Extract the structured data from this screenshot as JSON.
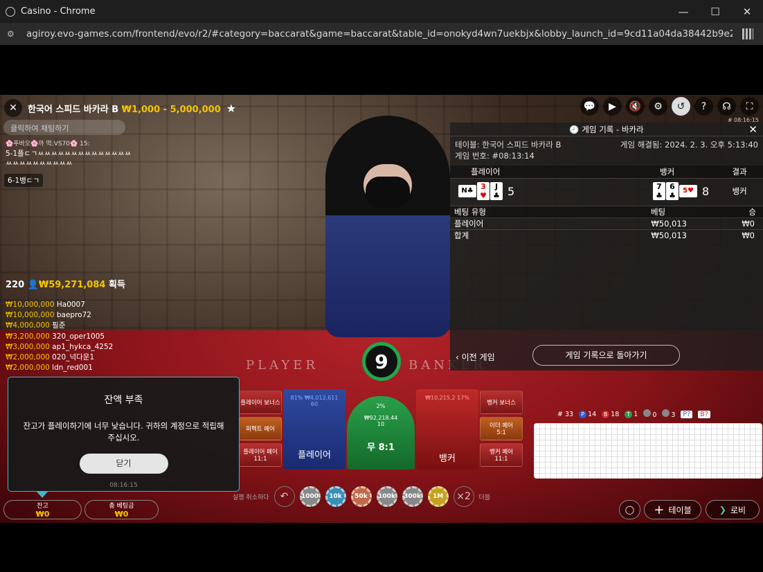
{
  "window": {
    "title": "Casino - Chrome",
    "url": "agiroy.evo-games.com/frontend/evo/r2/#category=baccarat&game=baccarat&table_id=onokyd4wn7uekbjx&lobby_launch_id=9cd11a04da38442b9e233af824b..."
  },
  "game": {
    "table_name": "한국어 스피드 바카라 B",
    "limits": "₩1,000 - 5,000,000",
    "round_id": "# 08:16:15",
    "timer": "9",
    "felt_player": "PLAYER",
    "felt_banker": "BANKER"
  },
  "chat": {
    "placeholder": "클릭하여 채팅하기",
    "meta": "🌸푸바오🌸까 먹:VS70🌸 15:",
    "message": "5-1플ㄷㄱㅆㅆㅆㅆㅆㅆㅆㅆㅆㅆㅆㅆㅆㅆㅆㅆㅆㅆㅆㅆㅆㅆㅆㅆ",
    "pill": "6-1뱅ㄷㄱ"
  },
  "winners": {
    "count": "220",
    "total": "₩59,271,084",
    "suffix": "획득",
    "list": [
      {
        "amount": "₩10,000,000",
        "name": "Ha0007"
      },
      {
        "amount": "₩10,000,000",
        "name": "baepro72"
      },
      {
        "amount": "₩4,000,000",
        "name": "필준"
      },
      {
        "amount": "₩3,200,000",
        "name": "320_oper1005"
      },
      {
        "amount": "₩3,000,000",
        "name": "ap1_hykca_4252"
      },
      {
        "amount": "₩2,000,000",
        "name": "020_넉다운1"
      },
      {
        "amount": "₩2,000,000",
        "name": "ldn_red001"
      }
    ]
  },
  "history": {
    "title": "게임 기록 - 바카라",
    "table": "테이블: 한국어 스피드 바카라 B",
    "resolved": "게임 해결됨: 2024. 2. 3. 오후 5:13:40",
    "game_no": "게임 번호: #08:13:14",
    "col_player": "플레이어",
    "col_banker": "뱅커",
    "col_result": "결과",
    "player_score": "5",
    "banker_score": "8",
    "result": "뱅커",
    "bet_type": "베팅 유형",
    "bet_col": "베팅",
    "win_col": "승",
    "rows": [
      {
        "type": "플레이어",
        "bet": "₩50,013",
        "win": "₩0"
      },
      {
        "type": "합계",
        "bet": "₩50,013",
        "win": "₩0"
      }
    ],
    "prev": "이전 게임",
    "back": "게임 기록으로 돌아가기"
  },
  "bets": {
    "player_bonus": "플레이어 보너스",
    "perfect_pair": "퍼펙트 페어",
    "player_pair": "플레이어 페어",
    "player_pair_odds": "11:1",
    "player": "플레이어",
    "player_pct": "81%",
    "player_amount": "₩4,012,611",
    "player_count": "60",
    "tie": "무 8:1",
    "tie_pct": "2%",
    "tie_amount": "₩92,218.44",
    "tie_count": "10",
    "banker": "뱅커",
    "banker_amount": "₩10,215,2",
    "banker_pct": "17%",
    "banker_bonus": "뱅커 보너스",
    "either_pair": "이더 페어",
    "either_pair_odds": "5:1",
    "banker_pair": "뱅커 페어",
    "banker_pair_odds": "11:1"
  },
  "road": {
    "total": "# 33",
    "p_label": "P",
    "p": "14",
    "b_label": "B",
    "b": "18",
    "t_label": "T",
    "t": "1",
    "pp": "0",
    "bp": "3",
    "p_ask": "P?",
    "b_ask": "B?"
  },
  "chips": {
    "undo_label": "실행 취소하다",
    "values": [
      "1000",
      "10k",
      "50k",
      "100k",
      "300k",
      "1M"
    ],
    "double": "×2",
    "double_label": "더블"
  },
  "footer": {
    "balance_label": "잔고",
    "balance": "₩0",
    "totalbet_label": "총 베팅금",
    "totalbet": "₩0",
    "table_btn": "테이블",
    "lobby_btn": "로비"
  },
  "modal": {
    "title": "잔액 부족",
    "body": "잔고가 플레이하기에 너무 낮습니다. 귀하의 계정으로 적립해 주십시오.",
    "close": "닫기",
    "time": "08:16:15"
  }
}
